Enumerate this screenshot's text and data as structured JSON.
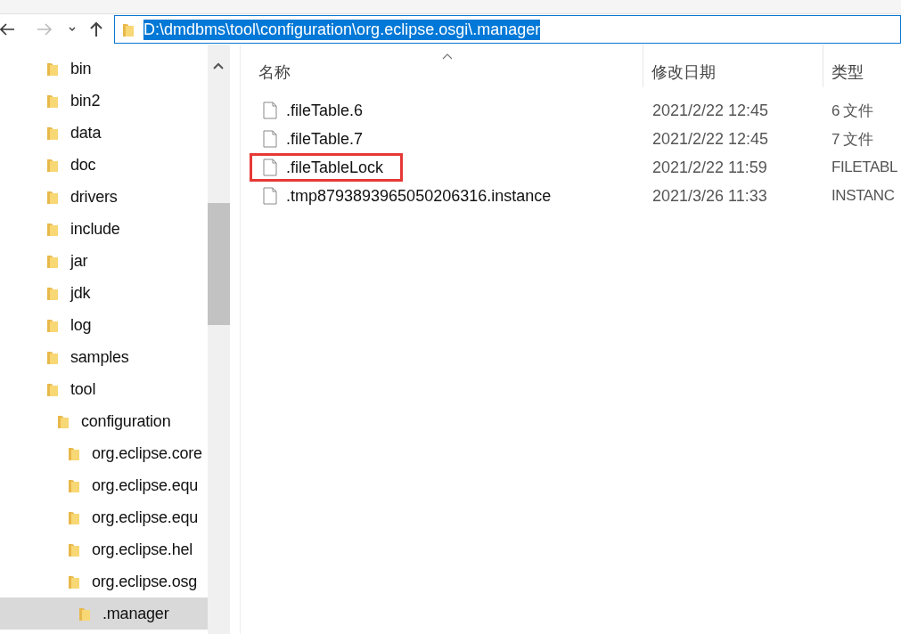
{
  "address_bar": {
    "path": "D:\\dmdbms\\tool\\configuration\\org.eclipse.osgi\\.manager",
    "selected": true
  },
  "sidebar": {
    "items": [
      {
        "label": "bin",
        "selected": false
      },
      {
        "label": "bin2",
        "selected": false
      },
      {
        "label": "data",
        "selected": false
      },
      {
        "label": "doc",
        "selected": false
      },
      {
        "label": "drivers",
        "selected": false
      },
      {
        "label": "include",
        "selected": false
      },
      {
        "label": "jar",
        "selected": false
      },
      {
        "label": "jdk",
        "selected": false
      },
      {
        "label": "log",
        "selected": false
      },
      {
        "label": "samples",
        "selected": false
      },
      {
        "label": "tool",
        "selected": false,
        "children": [
          {
            "label": "configuration",
            "selected": false,
            "children": [
              {
                "label": "org.eclipse.core",
                "selected": false
              },
              {
                "label": "org.eclipse.equ",
                "selected": false
              },
              {
                "label": "org.eclipse.equ",
                "selected": false
              },
              {
                "label": "org.eclipse.hel",
                "selected": false
              },
              {
                "label": "org.eclipse.osg",
                "selected": false,
                "children": [
                  {
                    "label": ".manager",
                    "selected": true
                  }
                ]
              }
            ]
          }
        ]
      }
    ]
  },
  "file_list": {
    "columns": [
      "名称",
      "修改日期",
      "类型"
    ],
    "rows": [
      {
        "name": ".fileTable.6",
        "modified": "2021/2/22 12:45",
        "type": "6 文件",
        "highlighted": false
      },
      {
        "name": ".fileTable.7",
        "modified": "2021/2/22 12:45",
        "type": "7 文件",
        "highlighted": false
      },
      {
        "name": ".fileTableLock",
        "modified": "2021/2/22 11:59",
        "type": "FILETABL",
        "highlighted": true
      },
      {
        "name": ".tmp8793893965050206316.instance",
        "modified": "2021/3/26 11:33",
        "type": "INSTANC",
        "highlighted": false
      }
    ]
  }
}
